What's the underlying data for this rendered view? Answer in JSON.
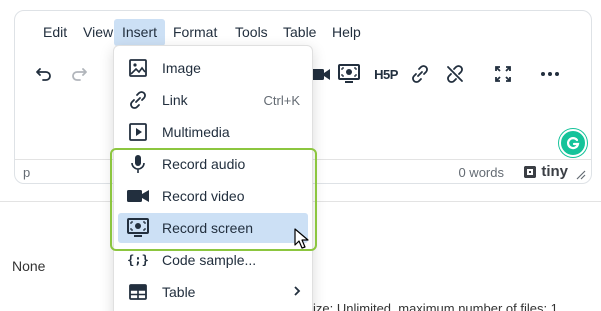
{
  "menubar": {
    "items": [
      {
        "label": "Edit"
      },
      {
        "label": "View"
      },
      {
        "label": "Insert",
        "active": true
      },
      {
        "label": "Format"
      },
      {
        "label": "Tools"
      },
      {
        "label": "Table"
      },
      {
        "label": "Help"
      }
    ]
  },
  "toolbar": {
    "icons": [
      "undo-icon",
      "redo-icon",
      "record-video-icon",
      "record-screen-icon",
      "h5p-icon",
      "link-icon",
      "unlink-icon",
      "fullscreen-icon",
      "more-icon"
    ],
    "h5p_label": "H5P"
  },
  "statusbar": {
    "path": "p",
    "wordcount": "0 words",
    "brand": "tiny"
  },
  "page": {
    "none_label": "None",
    "behind_text": "ize: Unlimited, maximum number of files: 1"
  },
  "insert_menu": {
    "items": [
      {
        "label": "Image",
        "icon": "image-icon",
        "shortcut": ""
      },
      {
        "label": "Link",
        "icon": "link-icon",
        "shortcut": "Ctrl+K"
      },
      {
        "label": "Multimedia",
        "icon": "multimedia-icon",
        "shortcut": ""
      },
      {
        "label": "Record audio",
        "icon": "microphone-icon",
        "shortcut": ""
      },
      {
        "label": "Record video",
        "icon": "video-camera-icon",
        "shortcut": ""
      },
      {
        "label": "Record screen",
        "icon": "screen-record-icon",
        "shortcut": "",
        "selected": true
      },
      {
        "label": "Code sample...",
        "icon": "code-sample-icon",
        "shortcut": ""
      },
      {
        "label": "Table",
        "icon": "table-icon",
        "shortcut": "",
        "submenu": true
      }
    ]
  },
  "colors": {
    "menu_active_bg": "#cce0f5",
    "highlight_border": "#8cc63f",
    "grammarly": "#15c39a"
  }
}
